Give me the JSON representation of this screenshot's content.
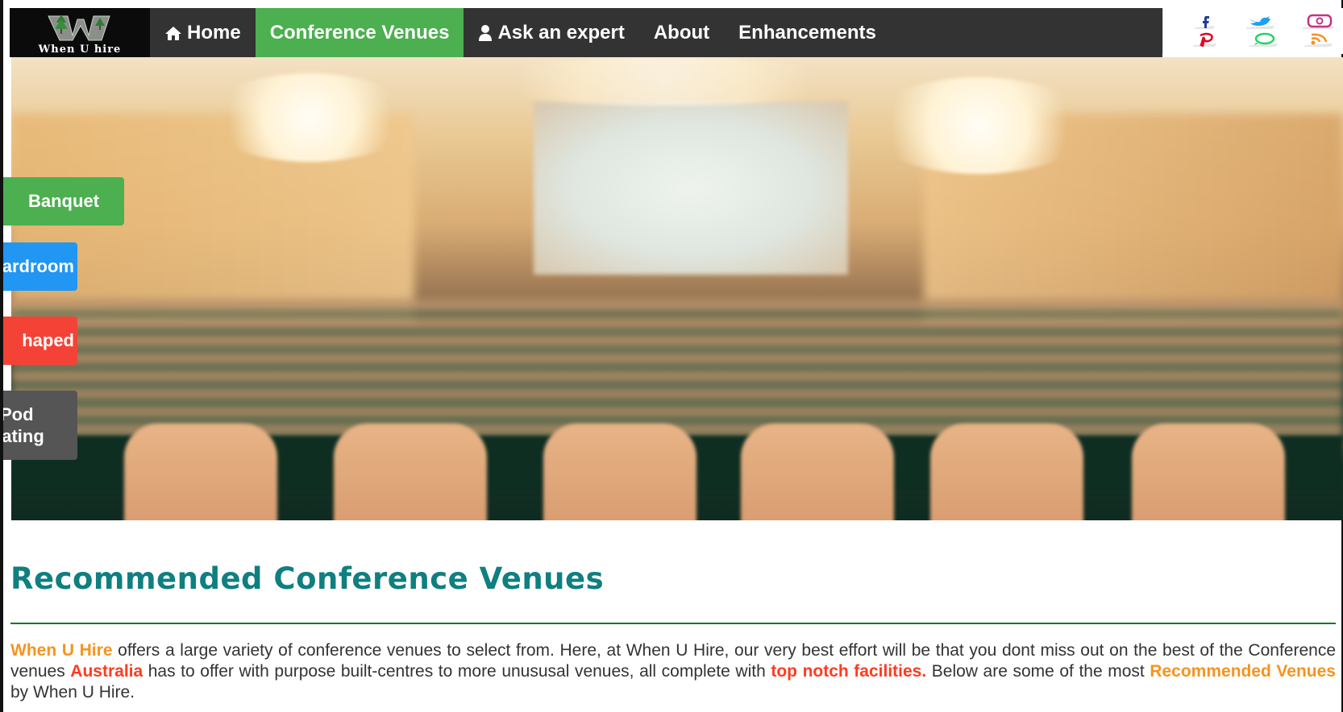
{
  "header": {
    "logo_text": "When U hire",
    "nav": [
      {
        "label": "Home",
        "icon": "home-icon"
      },
      {
        "label": "Conference Venues",
        "active": true
      },
      {
        "label": "Ask an expert",
        "icon": "user-icon"
      },
      {
        "label": "About"
      },
      {
        "label": "Enhancements"
      }
    ],
    "social_icons": [
      "facebook-icon",
      "twitter-icon",
      "instagram-icon",
      "pinterest-icon",
      "whatsapp-icon",
      "rss-icon"
    ]
  },
  "side_tabs": [
    {
      "label": "Banquet",
      "color": "#4caf50"
    },
    {
      "label": "Boardroom",
      "visible": "ardroom",
      "color": "#2196f3"
    },
    {
      "label": "U-Shaped",
      "visible": "haped",
      "color": "#f44336"
    },
    {
      "label": "Pod Seating",
      "visible_line1": "Pod",
      "visible_line2": "eating",
      "color": "#555555"
    }
  ],
  "content": {
    "heading": "Recommended Conference Venues",
    "para": {
      "brand": "When U Hire",
      "t1": " offers a large variety of conference venues to select from. Here, at When U Hire, our very best effort will be that you dont miss out on the best of the Conference venues ",
      "australia": "Australia",
      "t2": " has to offer with purpose built-centres to more unususal venues, all complete with ",
      "facilities": "top notch facilities.",
      "t3": " Below are some of the most ",
      "recommended": "Recommended Venues",
      "t4": " by When U Hire."
    }
  },
  "colors": {
    "nav_bg": "#333333",
    "active": "#4caf50",
    "heading": "#0f7f7f",
    "accent_orange": "#f7931e",
    "accent_red": "#ff3b1f"
  }
}
